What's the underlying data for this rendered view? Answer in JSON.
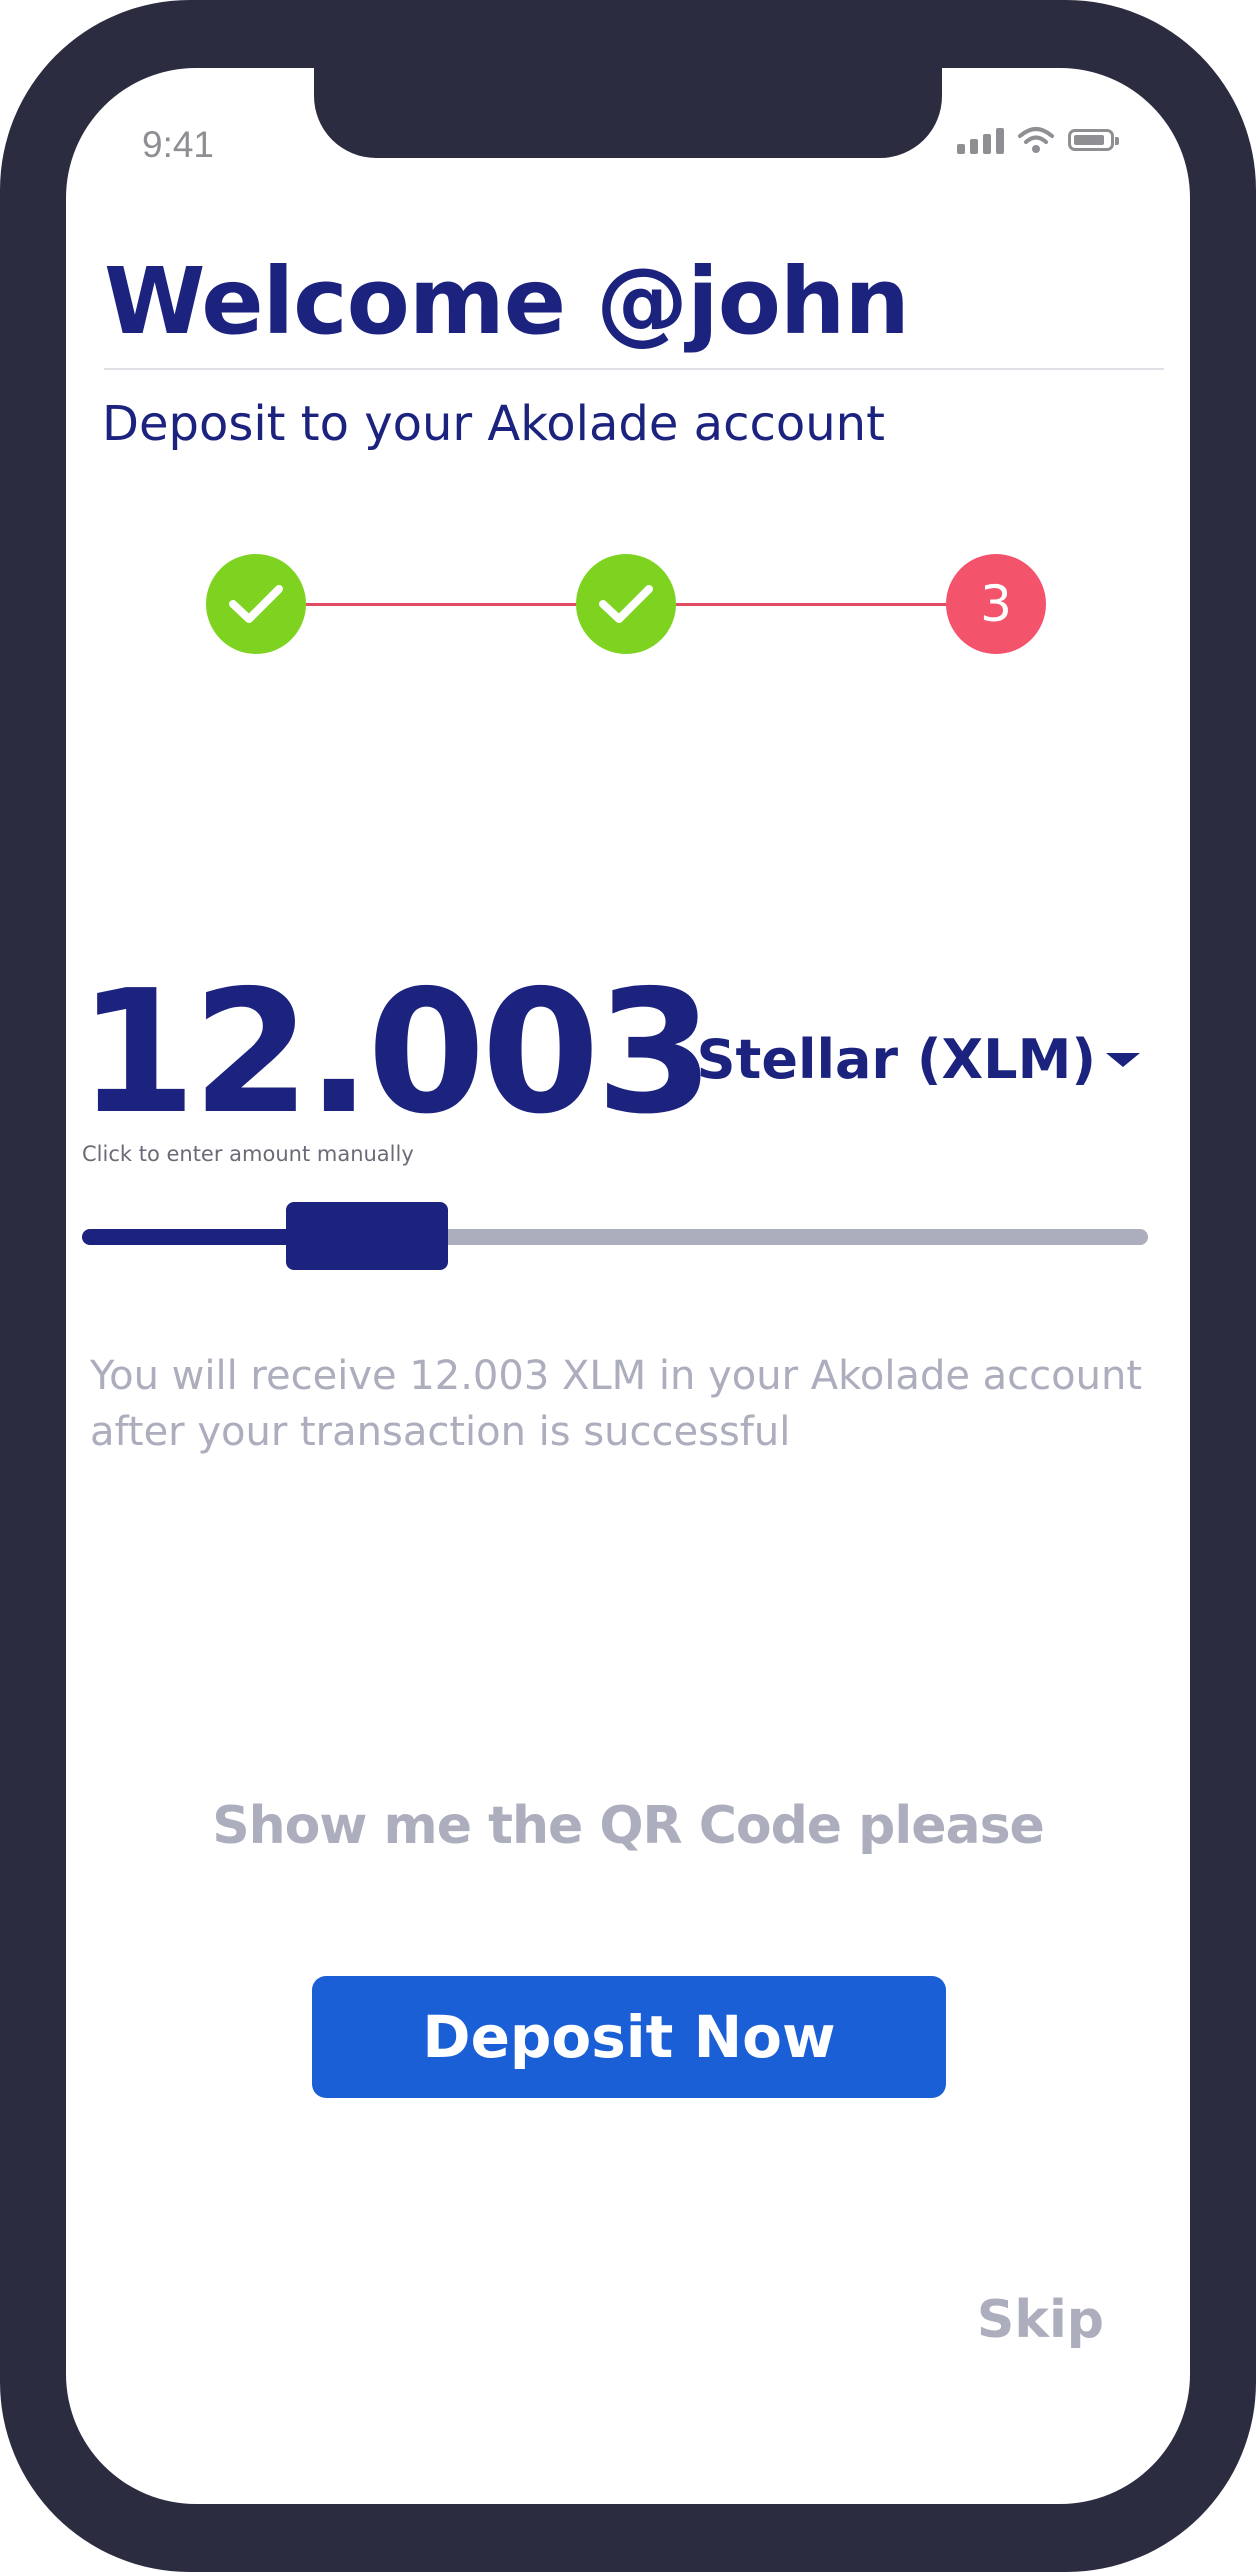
{
  "status_bar": {
    "time": "9:41",
    "signal_icon": "cellular-signal-icon",
    "wifi_icon": "wifi-icon",
    "battery_icon": "battery-icon"
  },
  "header": {
    "title": "Welcome @john",
    "subtitle": "Deposit to your Akolade account"
  },
  "stepper": {
    "steps": [
      {
        "state": "done",
        "icon": "checkmark-icon"
      },
      {
        "state": "done",
        "icon": "checkmark-icon"
      },
      {
        "state": "current",
        "label": "3"
      }
    ],
    "colors": {
      "done": "#7ed321",
      "current": "#f3536b",
      "line": "#e44c64"
    }
  },
  "deposit": {
    "amount": "12.003",
    "amount_hint": "Click to enter amount manually",
    "currency_label": "Stellar (XLM)",
    "currency_icon": "caret-down-icon",
    "slider_fraction": 0.25,
    "info_text": "You will receive 12.003 XLM in your Akolade account after your transaction is successful"
  },
  "actions": {
    "qr_link": "Show me the QR Code please",
    "deposit_button": "Deposit Now",
    "skip_link": "Skip"
  },
  "colors": {
    "brand_navy": "#1c237f",
    "primary_blue": "#1a5fd6",
    "muted_gray": "#acadbd",
    "device_frame": "#2c2c40"
  }
}
